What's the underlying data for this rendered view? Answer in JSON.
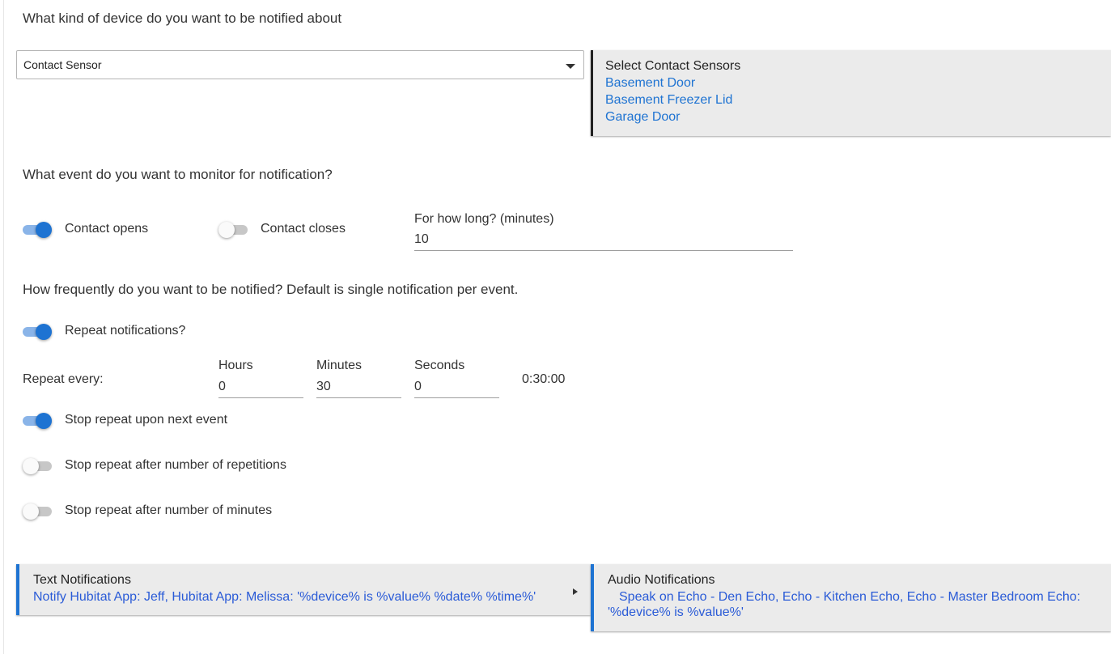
{
  "device_question": "What kind of device do you want to be notified about",
  "device_select": {
    "value": "Contact Sensor"
  },
  "sensors_panel": {
    "title": "Select Contact Sensors",
    "items": [
      "Basement Door",
      "Basement Freezer Lid",
      "Garage Door"
    ]
  },
  "event_question": "What event do you want to monitor for notification?",
  "events": {
    "opens_label": "Contact opens",
    "opens_on": true,
    "closes_label": "Contact closes",
    "closes_on": false,
    "duration_label": "For how long? (minutes)",
    "duration_value": "10"
  },
  "frequency_question": "How frequently do you want to be notified?  Default is single notification per event.",
  "repeat": {
    "toggle_label": "Repeat notifications?",
    "toggle_on": true,
    "every_label": "Repeat every:",
    "hours_label": "Hours",
    "hours_value": "0",
    "minutes_label": "Minutes",
    "minutes_value": "30",
    "seconds_label": "Seconds",
    "seconds_value": "0",
    "total": "0:30:00",
    "stop_next_label": "Stop repeat upon next event",
    "stop_next_on": true,
    "stop_reps_label": "Stop repeat after number of repetitions",
    "stop_reps_on": false,
    "stop_minutes_label": "Stop repeat after number of minutes",
    "stop_minutes_on": false
  },
  "text_notifications": {
    "title": "Text Notifications",
    "detail": "Notify Hubitat App: Jeff, Hubitat App: Melissa: '%device% is %value%  %date%  %time%'"
  },
  "audio_notifications": {
    "title": "Audio Notifications",
    "detail_line1": "Speak on  Echo - Den Echo, Echo - Kitchen Echo, Echo - Master Bedroom Echo:",
    "detail_line2": "'%device% is %value%'"
  },
  "colors": {
    "accent": "#1e73d2",
    "panel_bg": "#ebebeb"
  }
}
